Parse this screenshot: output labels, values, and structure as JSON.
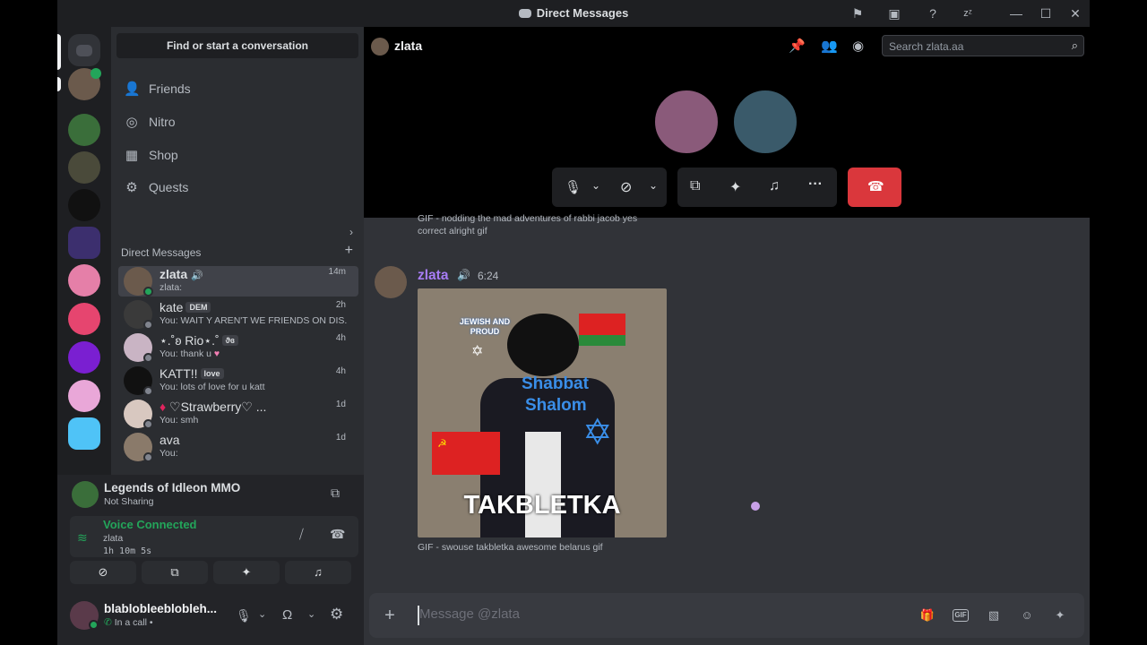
{
  "window": {
    "title": "Direct Messages"
  },
  "sidebar": {
    "find_label": "Find or start a conversation",
    "nav": [
      {
        "label": "Friends"
      },
      {
        "label": "Nitro"
      },
      {
        "label": "Shop"
      },
      {
        "label": "Quests"
      }
    ],
    "dm_header": "Direct Messages",
    "dms": [
      {
        "name": "zlata",
        "preview": "zlata:",
        "time": "14m"
      },
      {
        "name": "kate",
        "tag": "DEM",
        "preview": "You: WAIT Y AREN'T WE FRIENDS ON DIS...",
        "time": "2h"
      },
      {
        "name": "⋆.˚ʚ Rio⋆.˚",
        "tag": "ϑɞ",
        "preview": "You: thank u",
        "time": "4h"
      },
      {
        "name": "KATT!!",
        "tag": "love",
        "preview": "You: lots of love for u katt",
        "time": "4h"
      },
      {
        "name": "♡Strawberry♡ ...",
        "preview": "You: smh",
        "time": "1d"
      },
      {
        "name": "ava",
        "preview": "You:",
        "time": "1d"
      }
    ]
  },
  "activity": {
    "game": "Legends of Idleon MMO",
    "status": "Not Sharing"
  },
  "voice": {
    "status": "Voice Connected",
    "channel": "zlata",
    "duration": "1h 10m 5s"
  },
  "user": {
    "name": "blablobleeblobleh...",
    "status": "In a call •"
  },
  "header": {
    "channel": "zlata",
    "search_placeholder": "Search zlata.aa"
  },
  "messages": {
    "prev_caption": "GIF - nodding the mad adventures of rabbi jacob yes correct alright gif",
    "author": "zlata",
    "time": "6:24",
    "gif_text": {
      "top": "JEWISH AND PROUD",
      "mid1": "Shabbat",
      "mid2": "Shalom",
      "bottom": "TAKBLETKA"
    },
    "gif_caption": "GIF - swouse takbletka awesome belarus gif"
  },
  "composer": {
    "placeholder": "Message @zlata"
  },
  "colors": {
    "accent_green": "#23a55a",
    "hangup_red": "#da373c",
    "author_purple": "#a77cf5"
  }
}
